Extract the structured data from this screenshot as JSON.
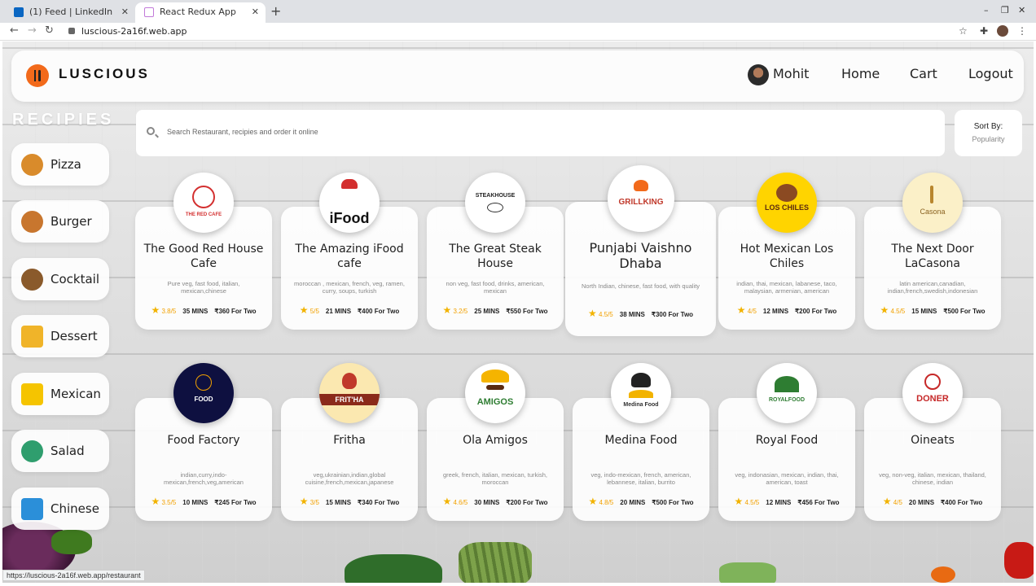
{
  "browser": {
    "tabs": [
      {
        "label": "(1) Feed | LinkedIn",
        "active": false
      },
      {
        "label": "React Redux App",
        "active": true
      }
    ],
    "url": "luscious-2a16f.web.app",
    "status_url": "https://luscious-2a16f.web.app/restaurant"
  },
  "header": {
    "brand": "LUSCIOUS",
    "user_name": "Mohit",
    "nav": [
      "Home",
      "Cart",
      "Logout"
    ]
  },
  "sidebar": {
    "title": "RECIPIES",
    "items": [
      {
        "label": "Pizza",
        "color": "#d98b2b"
      },
      {
        "label": "Burger",
        "color": "#c8762e"
      },
      {
        "label": "Cocktail",
        "color": "#8a5a2b"
      },
      {
        "label": "Dessert",
        "color": "#f0b429"
      },
      {
        "label": "Mexican",
        "color": "#f5c400"
      },
      {
        "label": "Salad",
        "color": "#2f9e6e"
      },
      {
        "label": "Chinese",
        "color": "#2b8fd9"
      }
    ]
  },
  "search": {
    "placeholder": "Search Restaurant, recipies and order it online",
    "sort_label": "Sort By:",
    "sort_value": "Popularity"
  },
  "restaurants": [
    {
      "name": "The Good Red House Cafe",
      "logo_text": "THE RED CAFE",
      "cuisine": "Pure veg, fast food, italian, mexican,chinese",
      "rating": "3.8/5",
      "time": "35 MINS",
      "price": "₹360 For Two"
    },
    {
      "name": "The Amazing iFood cafe",
      "logo_text": "iFood",
      "cuisine": "moroccan , mexican, french, veg, ramen, curry, soups, turkish",
      "rating": "5/5",
      "time": "21 MINS",
      "price": "₹400 For Two"
    },
    {
      "name": "The Great Steak House",
      "logo_text": "STEAKHOUSE",
      "cuisine": "non veg, fast food, drinks, american, mexican",
      "rating": "3.2/5",
      "time": "25 MINS",
      "price": "₹550 For Two"
    },
    {
      "name": "Punjabi Vaishno Dhaba",
      "logo_text": "GRILLKING",
      "cuisine": "North Indian, chinese, fast food, with quality",
      "rating": "4.5/5",
      "time": "38 MINS",
      "price": "₹300 For Two"
    },
    {
      "name": "Hot Mexican Los Chiles",
      "logo_text": "LOS CHILES",
      "cuisine": "indian, thai, mexican, labanese, taco, malaysian, armenian, american",
      "rating": "4/5",
      "time": "12 MINS",
      "price": "₹200 For Two"
    },
    {
      "name": "The Next Door LaCasona",
      "logo_text": "Casona",
      "cuisine": "latin american,canadian, indian,french,swedish,indonesian",
      "rating": "4.5/5",
      "time": "15 MINS",
      "price": "₹500 For Two"
    },
    {
      "name": "Food Factory",
      "logo_text": "FOOD",
      "cuisine": "indian,curry,indo-mexican,french,veg,american",
      "rating": "3.5/5",
      "time": "10 MINS",
      "price": "₹245 For Two"
    },
    {
      "name": "Fritha",
      "logo_text": "FRIT'HA",
      "cuisine": "veg,ukrainian,indian,global cuisine,french,mexican,japanese",
      "rating": "3/5",
      "time": "15 MINS",
      "price": "₹340 For Two"
    },
    {
      "name": "Ola Amigos",
      "logo_text": "AMIGOS",
      "cuisine": "greek, french, italian, mexican, turkish, moroccan",
      "rating": "4.6/5",
      "time": "30 MINS",
      "price": "₹200 For Two"
    },
    {
      "name": "Medina Food",
      "logo_text": "Medina Food",
      "cuisine": "veg, indo-mexican, french, american, lebannese, italian, burrito",
      "rating": "4.8/5",
      "time": "20 MINS",
      "price": "₹500 For Two"
    },
    {
      "name": "Royal Food",
      "logo_text": "ROYALFOOD",
      "cuisine": "veg, indonasian, mexican, indian, thai, american, toast",
      "rating": "4.5/5",
      "time": "12 MINS",
      "price": "₹456 For Two"
    },
    {
      "name": "Oineats",
      "logo_text": "DONER",
      "cuisine": "veg, non-veg, italian, mexican, thailand, chinese, indian",
      "rating": "4/5",
      "time": "20 MINS",
      "price": "₹400 For Two"
    }
  ]
}
